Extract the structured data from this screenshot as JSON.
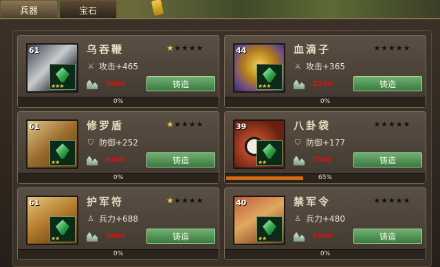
{
  "tabs": [
    {
      "label": "兵器",
      "active": true
    },
    {
      "label": "宝石",
      "active": false
    }
  ],
  "items": [
    {
      "level": "61",
      "name": "乌吞鞭",
      "stars": 1,
      "max_stars": 5,
      "stat_icon": "sword-icon",
      "stat": "攻击+465",
      "gem_stars": "★★★",
      "cost": "8000",
      "button": "铸造",
      "progress": 0,
      "progress_label": "0%",
      "art": "linear-gradient(135deg,#3a4048,#c8ccd0 45%,#4a5058 70%,#1f2328)"
    },
    {
      "level": "44",
      "name": "血滴子",
      "stars": 0,
      "max_stars": 5,
      "stat_icon": "sword-icon",
      "stat": "攻击+365",
      "gem_stars": "★★★",
      "cost": "2200",
      "button": "铸造",
      "progress": 0,
      "progress_label": "0%",
      "art": "radial-gradient(circle at 50% 45%,#f5d25a,#b07c1a 45%,#6a4a8a 75%,#3a2a55)"
    },
    {
      "level": "61",
      "name": "修罗盾",
      "stars": 1,
      "max_stars": 5,
      "stat_icon": "shield-icon",
      "stat": "防御+252",
      "gem_stars": "★★",
      "cost": "8000",
      "button": "铸造",
      "progress": 0,
      "progress_label": "0%",
      "art": "linear-gradient(140deg,#e0c68a,#9a6c2c 50%,#5b3c16)"
    },
    {
      "level": "39",
      "name": "八卦袋",
      "stars": 0,
      "max_stars": 5,
      "stat_icon": "shield-icon",
      "stat": "防御+177",
      "gem_stars": "★★",
      "cost": "7800",
      "button": "铸造",
      "progress": 0.65,
      "progress_label": "65%",
      "art": "radial-gradient(circle at 40% 55%,#f0ece0 0 18%,#1a1a1a 19% 24%,#b84a2a 25%,#6a2010 70%)"
    },
    {
      "level": "61",
      "name": "护军符",
      "stars": 1,
      "max_stars": 5,
      "stat_icon": "troop-icon",
      "stat": "兵力+688",
      "gem_stars": "★★",
      "cost": "8000",
      "button": "铸造",
      "progress": 0,
      "progress_label": "0%",
      "art": "linear-gradient(150deg,#e8c478,#b0782a 50%,#5a3a14)"
    },
    {
      "level": "40",
      "name": "禁军令",
      "stars": 0,
      "max_stars": 5,
      "stat_icon": "troop-icon",
      "stat": "兵力+480",
      "gem_stars": "★★",
      "cost": "2900",
      "button": "铸造",
      "progress": 0,
      "progress_label": "0%",
      "art": "linear-gradient(150deg,#c05a3a,#e0a860 45%,#6a2a18)"
    }
  ]
}
